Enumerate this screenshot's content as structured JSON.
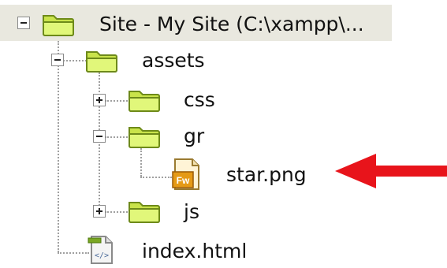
{
  "tree": {
    "root": {
      "label": "Site - My Site (C:\\xampp\\...",
      "expanded": true,
      "icon": "folder-icon"
    },
    "items": [
      {
        "label": "assets",
        "expanded": true,
        "icon": "folder-icon"
      },
      {
        "label": "css",
        "expanded": false,
        "icon": "folder-icon"
      },
      {
        "label": "gr",
        "expanded": true,
        "icon": "folder-icon"
      },
      {
        "label": "star.png",
        "icon": "fireworks-png-icon",
        "badge": "Fw"
      },
      {
        "label": "js",
        "expanded": false,
        "icon": "folder-icon"
      },
      {
        "label": "index.html",
        "icon": "html-file-icon"
      }
    ]
  },
  "colors": {
    "root_row_bg": "#e9e8df",
    "folder_fill": "#d6f05a",
    "folder_stroke": "#6e8a1a",
    "arrow": "#e8141b",
    "fw_badge": "#e59a16"
  },
  "annotation": {
    "icon": "red-arrow-icon",
    "points_to": "star.png"
  }
}
